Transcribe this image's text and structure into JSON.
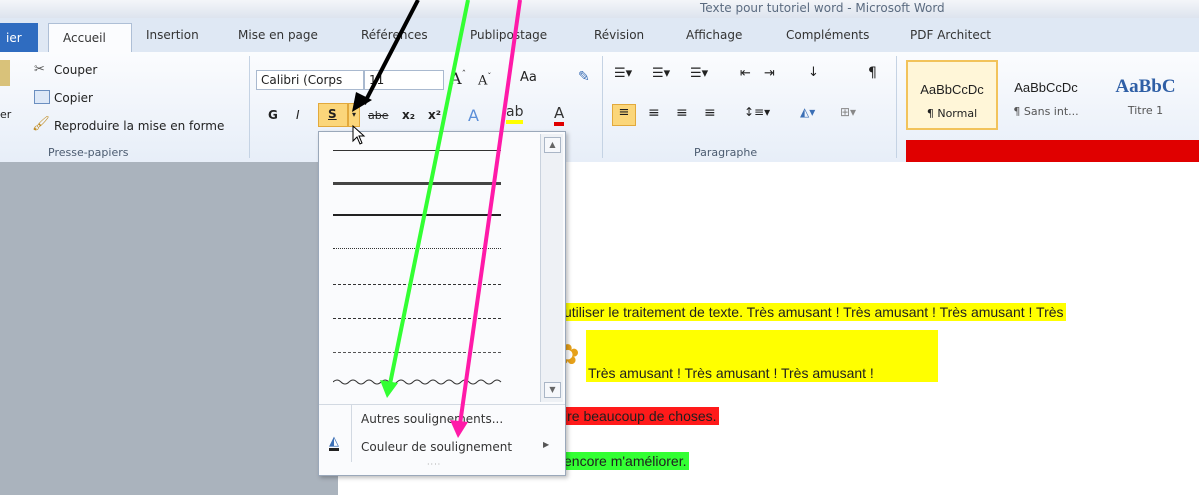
{
  "window": {
    "title": "Texte pour tutoriel word - Microsoft Word"
  },
  "tabs": [
    {
      "label": "ier"
    },
    {
      "label": "Accueil"
    },
    {
      "label": "Insertion"
    },
    {
      "label": "Mise en page"
    },
    {
      "label": "Références"
    },
    {
      "label": "Publipostage"
    },
    {
      "label": "Révision"
    },
    {
      "label": "Affichage"
    },
    {
      "label": "Compléments"
    },
    {
      "label": "PDF Architect"
    }
  ],
  "clipboard": {
    "cut": "Couper",
    "copy": "Copier",
    "format_painter": "Reproduire la mise en forme",
    "group_label": "Presse-papiers",
    "paste_partial": "er"
  },
  "font": {
    "name": "Calibri (Corps",
    "size": "11",
    "bold": "G",
    "italic": "I",
    "underline": "S",
    "strike": "abe",
    "subscript": "x₂",
    "superscript": "x²",
    "case": "Aa"
  },
  "paragraph": {
    "group_label": "Paragraphe"
  },
  "styles": [
    {
      "preview": "AaBbCcDc",
      "label": "¶ Normal"
    },
    {
      "preview": "AaBbCcDc",
      "label": "¶ Sans int..."
    },
    {
      "preview": "AaBbC",
      "label": "Titre 1"
    }
  ],
  "underline_menu": {
    "more": "Autres soulignements...",
    "color": "Couleur de soulignement"
  },
  "document": {
    "line1": "utiliser le traitement de texte. Très amusant ! Très amusant ! Très amusant ! Très",
    "line2": "Très amusant ! Très amusant ! Très amusant !",
    "line3": "ire beaucoup de choses.",
    "line4": "encore m'améliorer."
  },
  "colors": {
    "highlight_yellow": "#ffff00",
    "highlight_red": "#ff1a1a",
    "highlight_green": "#33ff33",
    "arrow_black": "#000000",
    "arrow_green": "#33ff33",
    "arrow_pink": "#ff1aa8"
  }
}
